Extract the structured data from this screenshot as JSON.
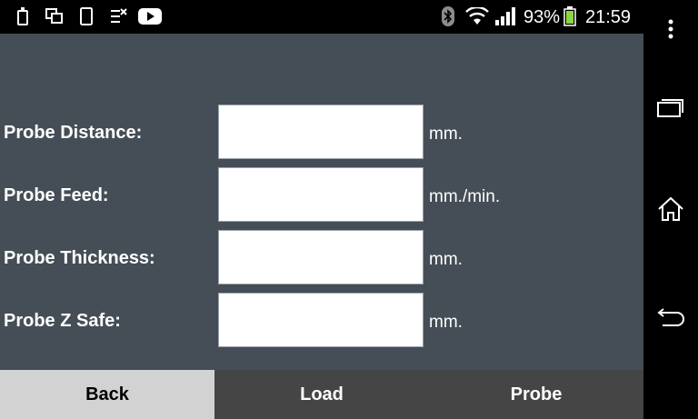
{
  "status_bar": {
    "battery_percent": "93%",
    "time": "21:59",
    "icons": [
      "phone-icon",
      "screens-icon",
      "device-icon",
      "missed-call-icon",
      "youtube-icon",
      "bluetooth-icon",
      "wifi-icon",
      "signal-icon",
      "battery-icon"
    ]
  },
  "form": {
    "rows": [
      {
        "label": "Probe Distance:",
        "value": "",
        "unit": "mm."
      },
      {
        "label": "Probe Feed:",
        "value": "",
        "unit": "mm./min."
      },
      {
        "label": "Probe Thickness:",
        "value": "",
        "unit": "mm."
      },
      {
        "label": "Probe Z Safe:",
        "value": "",
        "unit": "mm."
      }
    ]
  },
  "buttons": {
    "back": "Back",
    "load": "Load",
    "probe": "Probe"
  },
  "nav": {
    "icons": [
      "menu-icon",
      "recent-apps-icon",
      "home-icon",
      "back-icon"
    ]
  },
  "colors": {
    "content_bg": "#454e56",
    "button_bar_bg": "#454545",
    "active_button_bg": "#d2d2d2",
    "battery": "#8bd63c"
  }
}
